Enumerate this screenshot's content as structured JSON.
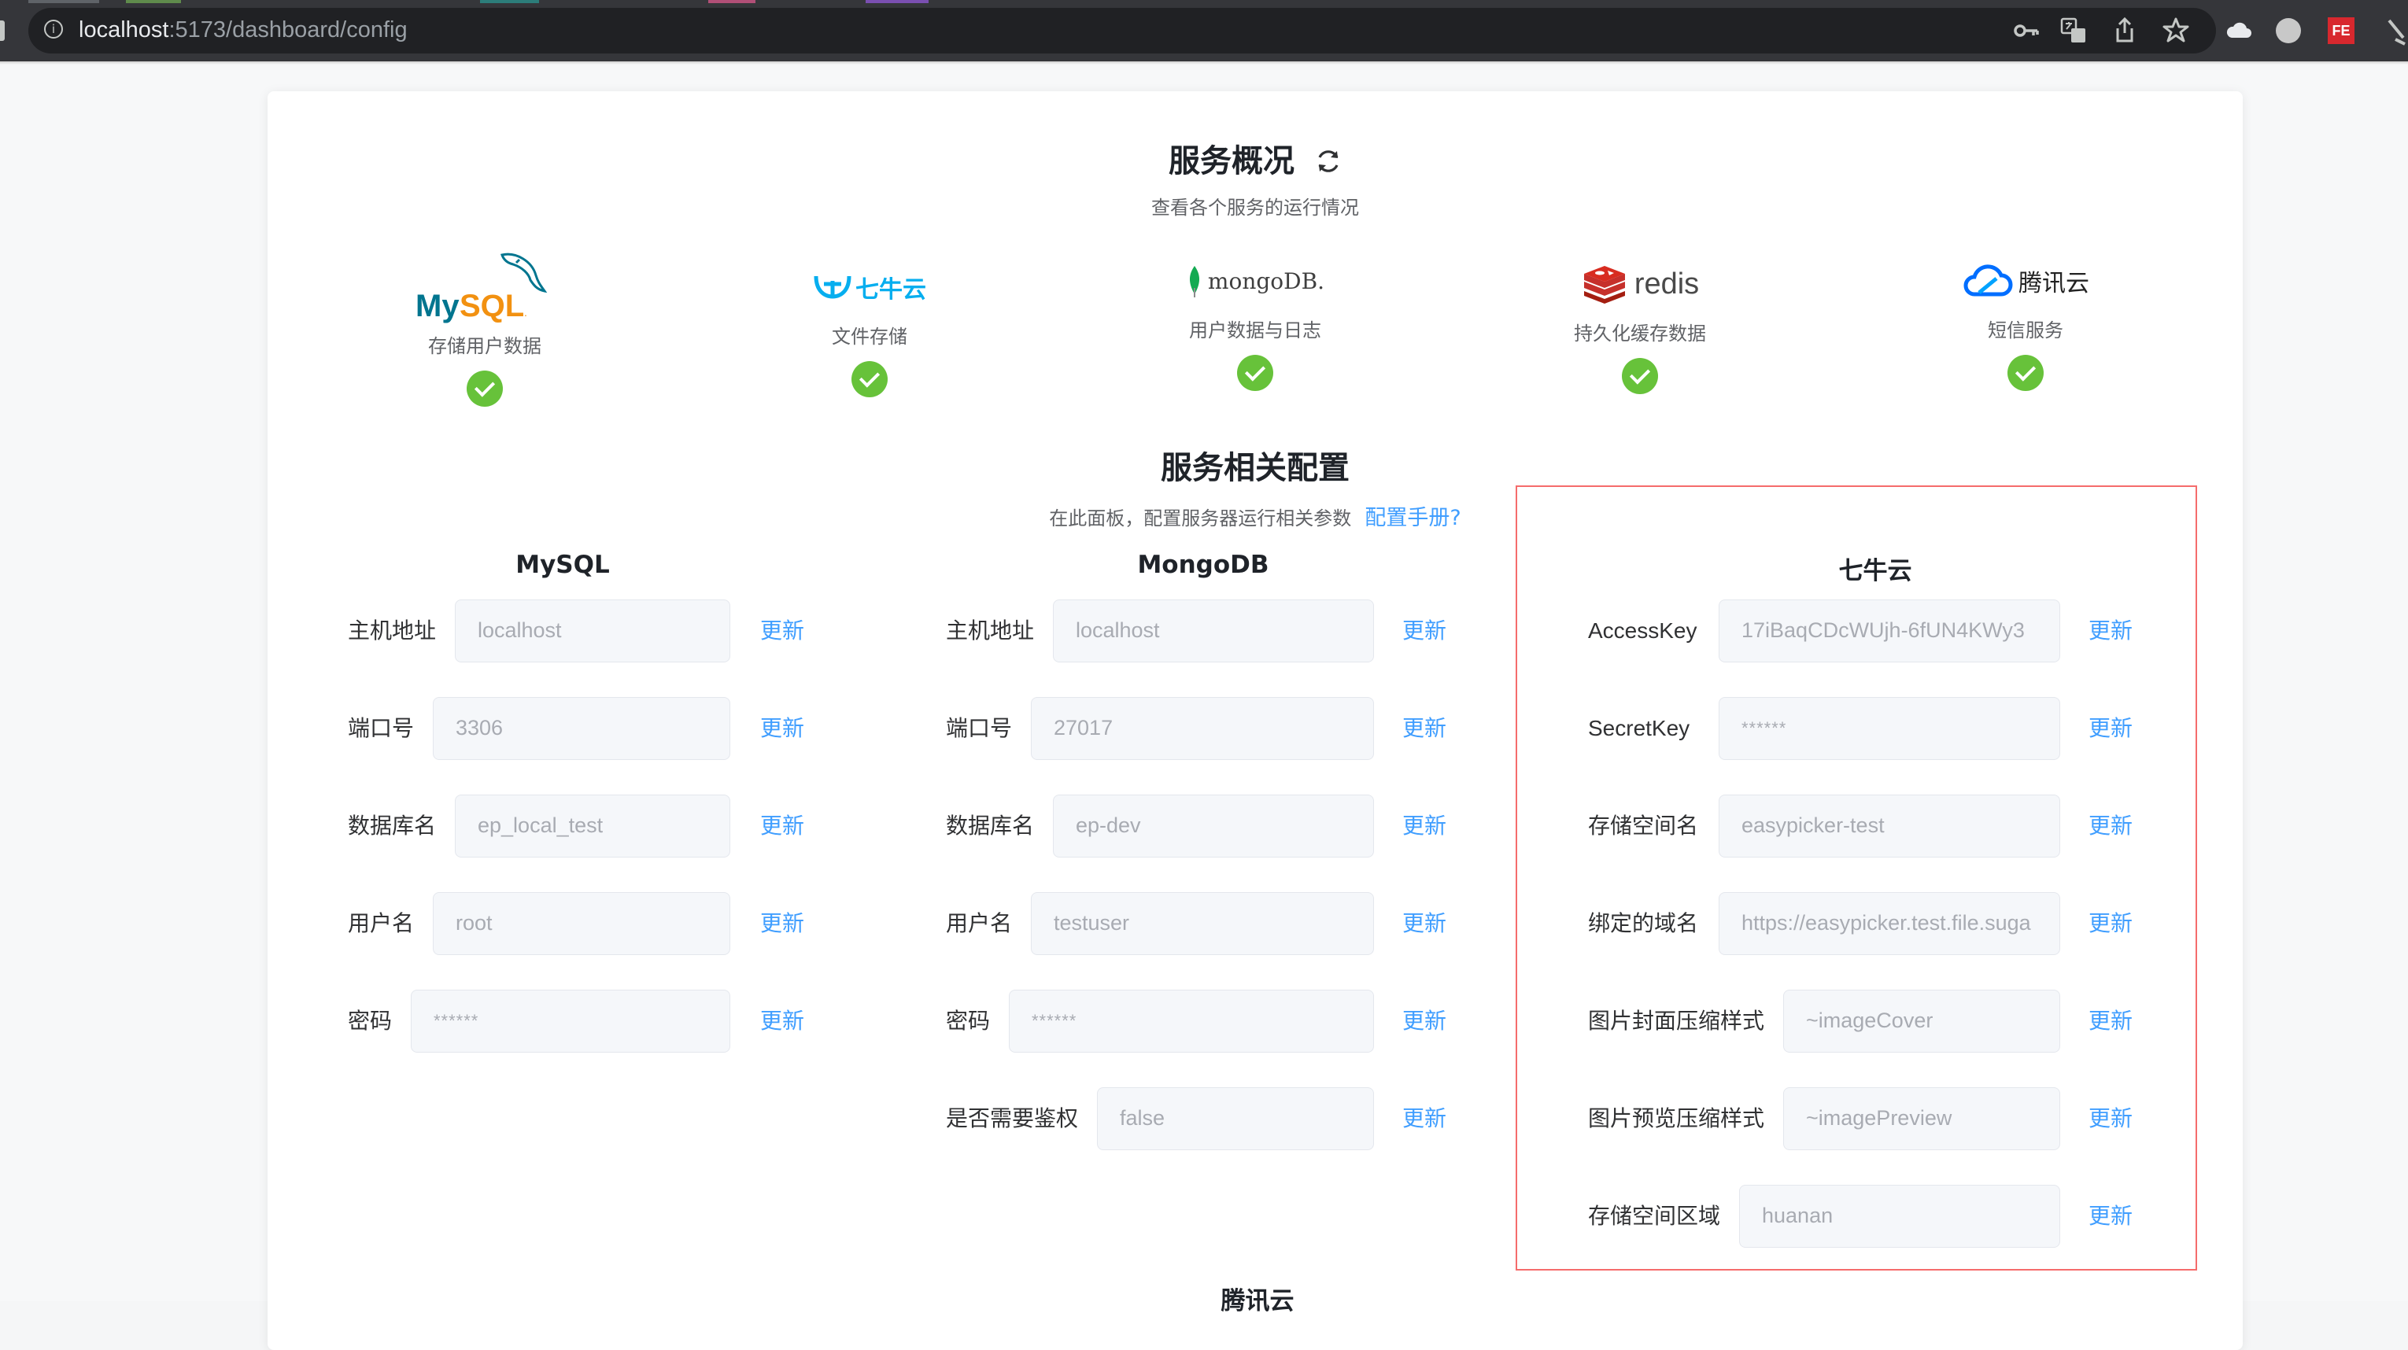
{
  "browser": {
    "url_host": "localhost",
    "url_path": ":5173/dashboard/config",
    "info_icon": "info-icon",
    "toolbar_icons": [
      "key-icon",
      "translate-icon",
      "share-icon",
      "bookmark-star-icon",
      "extension-cloud-icon",
      "profile-avatar",
      "fe-extension-icon",
      "more-icon"
    ],
    "fe_label": "FE"
  },
  "overview": {
    "title": "服务概况",
    "refresh_icon": "refresh-icon",
    "subtitle": "查看各个服务的运行情况",
    "services": [
      {
        "logo": "MySQL",
        "desc": "存储用户数据",
        "status": "ok"
      },
      {
        "logo": "七牛云",
        "desc": "文件存储",
        "status": "ok"
      },
      {
        "logo": "mongoDB.",
        "desc": "用户数据与日志",
        "status": "ok"
      },
      {
        "logo": "redis",
        "desc": "持久化缓存数据",
        "status": "ok"
      },
      {
        "logo": "腾讯云",
        "desc": "短信服务",
        "status": "ok"
      }
    ]
  },
  "config": {
    "title": "服务相关配置",
    "subtitle": "在此面板，配置服务器运行相关参数",
    "help_link": "配置手册?",
    "update_label": "更新",
    "mysql": {
      "title": "MySQL",
      "rows": [
        {
          "label": "主机地址",
          "value": "localhost"
        },
        {
          "label": "端口号",
          "value": "3306"
        },
        {
          "label": "数据库名",
          "value": "ep_local_test"
        },
        {
          "label": "用户名",
          "value": "root"
        },
        {
          "label": "密码",
          "value": "******"
        }
      ]
    },
    "mongodb": {
      "title": "MongoDB",
      "rows": [
        {
          "label": "主机地址",
          "value": "localhost"
        },
        {
          "label": "端口号",
          "value": "27017"
        },
        {
          "label": "数据库名",
          "value": "ep-dev"
        },
        {
          "label": "用户名",
          "value": "testuser"
        },
        {
          "label": "密码",
          "value": "******"
        },
        {
          "label": "是否需要鉴权",
          "value": "false"
        }
      ]
    },
    "qiniu": {
      "title": "七牛云",
      "rows": [
        {
          "label": "AccessKey",
          "value": "17iBaqCDcWUjh-6fUN4KWy3"
        },
        {
          "label": "SecretKey",
          "value": "******"
        },
        {
          "label": "存储空间名",
          "value": "easypicker-test"
        },
        {
          "label": "绑定的域名",
          "value": "https://easypicker.test.file.suga"
        },
        {
          "label": "图片封面压缩样式",
          "value": "~imageCover"
        },
        {
          "label": "图片预览压缩样式",
          "value": "~imagePreview"
        },
        {
          "label": "存储空间区域",
          "value": "huanan"
        }
      ]
    },
    "tencent_title": "腾讯云"
  },
  "colors": {
    "accent": "#409eff",
    "success": "#67c23a",
    "highlight_border": "#f56c6c"
  }
}
